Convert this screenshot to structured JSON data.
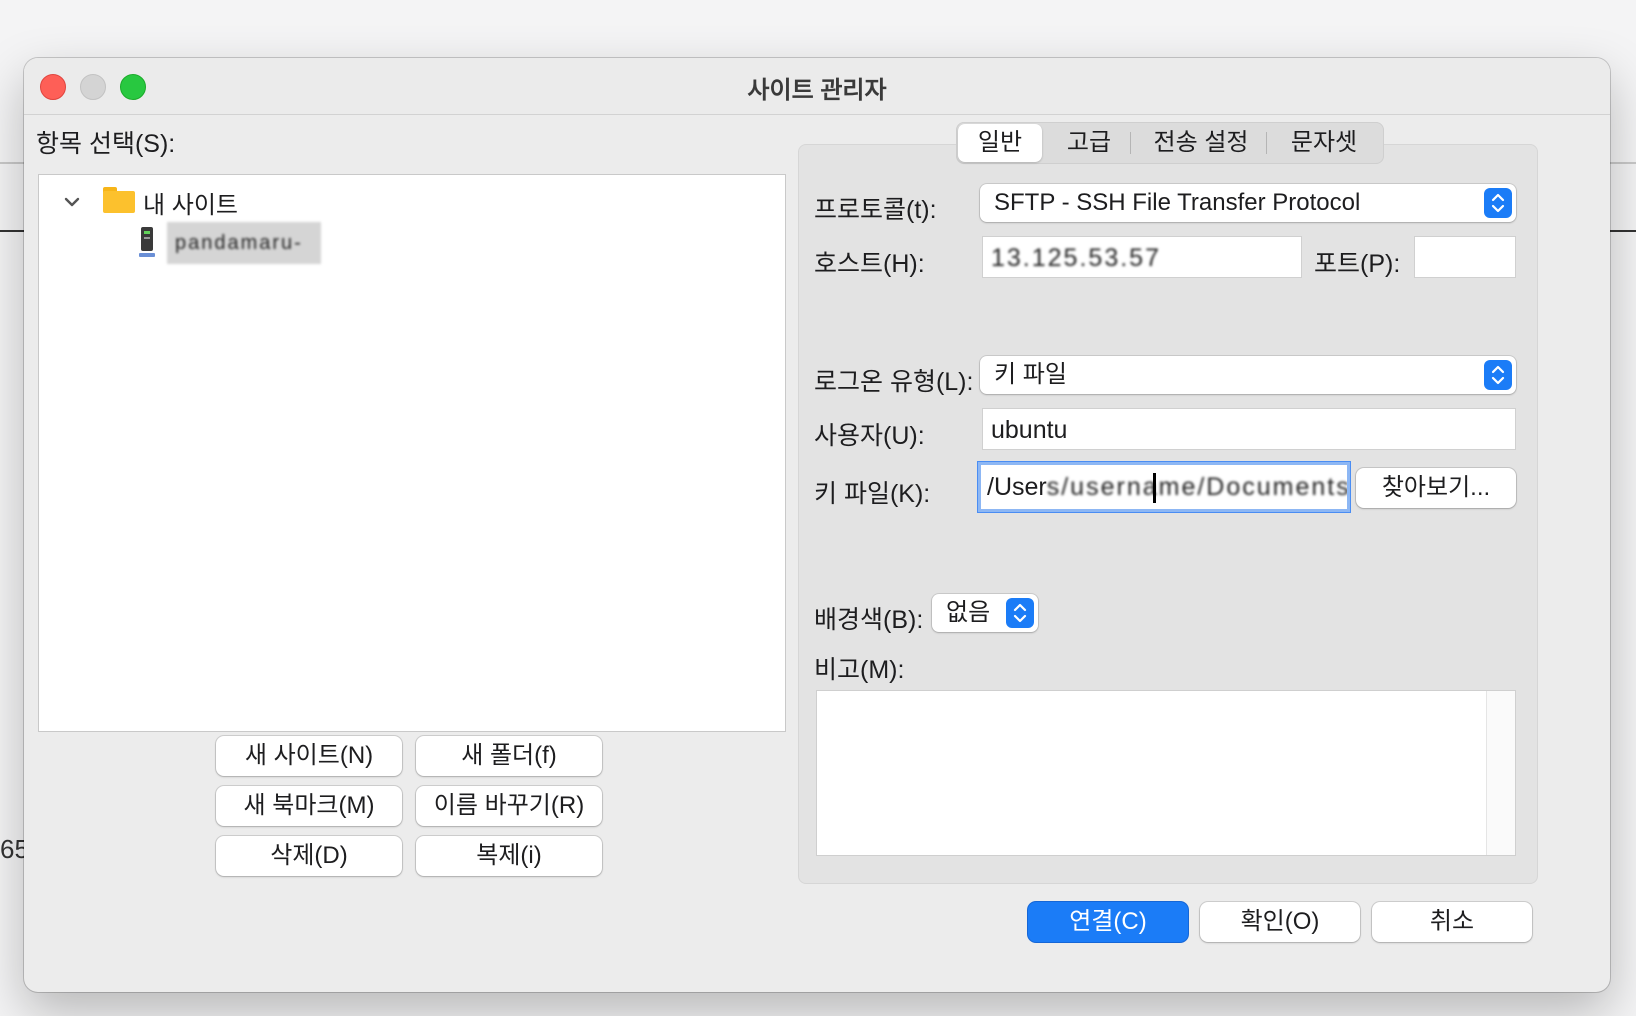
{
  "window": {
    "title": "사이트 관리자"
  },
  "left": {
    "select_label": "항목 선택(S):",
    "tree": {
      "root": "내 사이트",
      "site": "pandamaru-ol"
    },
    "buttons": {
      "new_site": "새 사이트(N)",
      "new_folder": "새 폴더(f)",
      "new_bookmark": "새 북마크(M)",
      "rename": "이름 바꾸기(R)",
      "delete": "삭제(D)",
      "duplicate": "복제(i)"
    }
  },
  "tabs": [
    "일반",
    "고급",
    "전송 설정",
    "문자셋"
  ],
  "form": {
    "protocol_label": "프로토콜(t):",
    "protocol_value": "SFTP - SSH File Transfer Protocol",
    "host_label": "호스트(H):",
    "host_value": "13.125.53.57",
    "port_label": "포트(P):",
    "port_value": "",
    "logon_label": "로그온 유형(L):",
    "logon_value": "키 파일",
    "user_label": "사용자(U):",
    "user_value": "ubuntu",
    "keyfile_label": "키 파일(K):",
    "keyfile_prefix": "/User",
    "keyfile_blurred": "s/username/Documents/Ke",
    "browse_label": "찾아보기...",
    "bgcolor_label": "배경색(B):",
    "bgcolor_value": "없음",
    "comment_label": "비고(M):",
    "comment_value": ""
  },
  "footer": {
    "connect": "연결(C)",
    "ok": "확인(O)",
    "cancel": "취소"
  },
  "background": {
    "fragment_text": "65"
  },
  "colors": {
    "accent": "#1b7cf7",
    "close": "#fe5f57",
    "zoom": "#28c840",
    "folder": "#fcc12d"
  }
}
